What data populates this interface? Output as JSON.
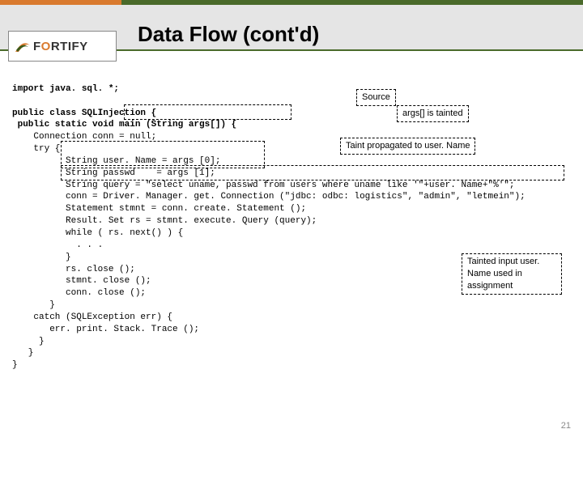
{
  "header": {
    "logo_text_left": "F",
    "logo_text_mid": "O",
    "logo_text_right": "RTIFY",
    "title": "Data Flow (cont'd)"
  },
  "code": {
    "l01": "import java. sql. *;",
    "l02": "",
    "l03": "public class SQLInjection {",
    "l04": " public static void main (String args[]) {",
    "l05": "    Connection conn = null;",
    "l06": "    try {",
    "l07": "          String user. Name = args [0];",
    "l08": "          String passwd    = args [1];",
    "l09": "          String query = \"select uname, passwd from users where uname like '\"+user. Name+\"%'\";",
    "l10": "          conn = Driver. Manager. get. Connection (\"jdbc: odbc: logistics\", \"admin\", \"letmein\");",
    "l11": "          Statement stmnt = conn. create. Statement ();",
    "l12": "          Result. Set rs = stmnt. execute. Query (query);",
    "l13": "          while ( rs. next() ) {",
    "l14": "            . . .",
    "l15": "          }",
    "l16": "          rs. close ();",
    "l17": "          stmnt. close ();",
    "l18": "          conn. close ();",
    "l19": "       }",
    "l20": "    catch (SQLException err) {",
    "l21": "       err. print. Stack. Trace ();",
    "l22": "     }",
    "l23": "   }",
    "l24": "}"
  },
  "annotations": {
    "source": "Source",
    "args_tainted": "args[] is tainted",
    "taint_prop": "Taint propagated to user. Name",
    "tainted_input": "Tainted input user. Name used in assignment"
  },
  "page_number": "21"
}
